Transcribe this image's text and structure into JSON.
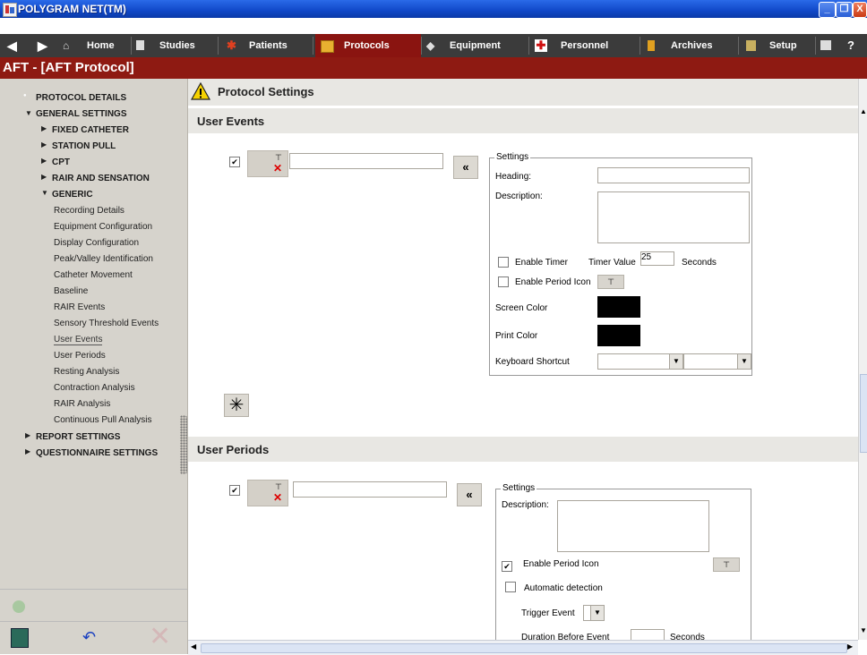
{
  "window": {
    "title": "POLYGRAM NET(TM)",
    "controls": [
      "_",
      "❐",
      "X"
    ]
  },
  "nav": {
    "items": [
      {
        "label": "Home"
      },
      {
        "label": "Studies"
      },
      {
        "label": "Patients"
      },
      {
        "label": "Protocols",
        "active": true
      },
      {
        "label": "Equipment"
      },
      {
        "label": "Personnel"
      },
      {
        "label": "Archives"
      },
      {
        "label": "Setup"
      },
      {
        "label": "?"
      }
    ]
  },
  "header": {
    "title": "AFT - [AFT Protocol]"
  },
  "sidebar": {
    "tree": [
      {
        "label": "PROTOCOL DETAILS"
      },
      {
        "label": "GENERAL SETTINGS"
      },
      {
        "label": "FIXED CATHETER"
      },
      {
        "label": "STATION PULL"
      },
      {
        "label": "CPT"
      },
      {
        "label": "RAIR AND SENSATION"
      },
      {
        "label": "GENERIC"
      },
      {
        "label": "Recording Details"
      },
      {
        "label": "Equipment Configuration"
      },
      {
        "label": "Display Configuration"
      },
      {
        "label": "Peak/Valley Identification"
      },
      {
        "label": "Catheter Movement"
      },
      {
        "label": "Baseline"
      },
      {
        "label": "RAIR Events"
      },
      {
        "label": "Sensory Threshold Events"
      },
      {
        "label": "User Events",
        "selected": true
      },
      {
        "label": "User Periods"
      },
      {
        "label": "Resting Analysis"
      },
      {
        "label": "Contraction Analysis"
      },
      {
        "label": "RAIR Analysis"
      },
      {
        "label": "Continuous Pull Analysis"
      },
      {
        "label": "REPORT SETTINGS"
      },
      {
        "label": "QUESTIONNAIRE SETTINGS"
      }
    ]
  },
  "main": {
    "page_title": "Protocol Settings",
    "user_events": {
      "section_title": "User Events",
      "row": {
        "checked": true,
        "name_value": ""
      },
      "settings": {
        "legend": "Settings",
        "heading_label": "Heading:",
        "heading_value": "",
        "description_label": "Description:",
        "description_value": "",
        "enable_timer_label": "Enable Timer",
        "enable_timer_checked": false,
        "timer_value_label": "Timer Value",
        "timer_value": "25",
        "seconds_label": "Seconds",
        "enable_period_icon_label": "Enable Period Icon",
        "enable_period_icon_checked": false,
        "screen_color_label": "Screen Color",
        "screen_color": "#000000",
        "print_color_label": "Print Color",
        "print_color": "#000000",
        "keyboard_shortcut_label": "Keyboard Shortcut",
        "shortcut_modifier_value": "",
        "shortcut_key_value": ""
      }
    },
    "user_periods": {
      "section_title": "User Periods",
      "row": {
        "checked": true,
        "name_value": ""
      },
      "settings": {
        "legend": "Settings",
        "description_label": "Description:",
        "description_value": "",
        "enable_period_icon_label": "Enable Period Icon",
        "enable_period_icon_checked": true,
        "automatic_detection_label": "Automatic detection",
        "automatic_detection_checked": false,
        "trigger_event_label": "Trigger Event",
        "trigger_event_value": "",
        "duration_before_event_label": "Duration Before Event",
        "duration_before_value": "",
        "duration_seconds_label": "Seconds"
      }
    }
  },
  "colors": {
    "titlebar": "#1048c8",
    "nav_bg": "#3b3b3b",
    "nav_active": "#8a1410",
    "header_bg": "#8e1a12",
    "sidebar_bg": "#d6d3cc"
  },
  "icons": {
    "move_left": "double-left-arrow-icon",
    "add": "asterisk-icon",
    "warning": "warning-icon"
  }
}
